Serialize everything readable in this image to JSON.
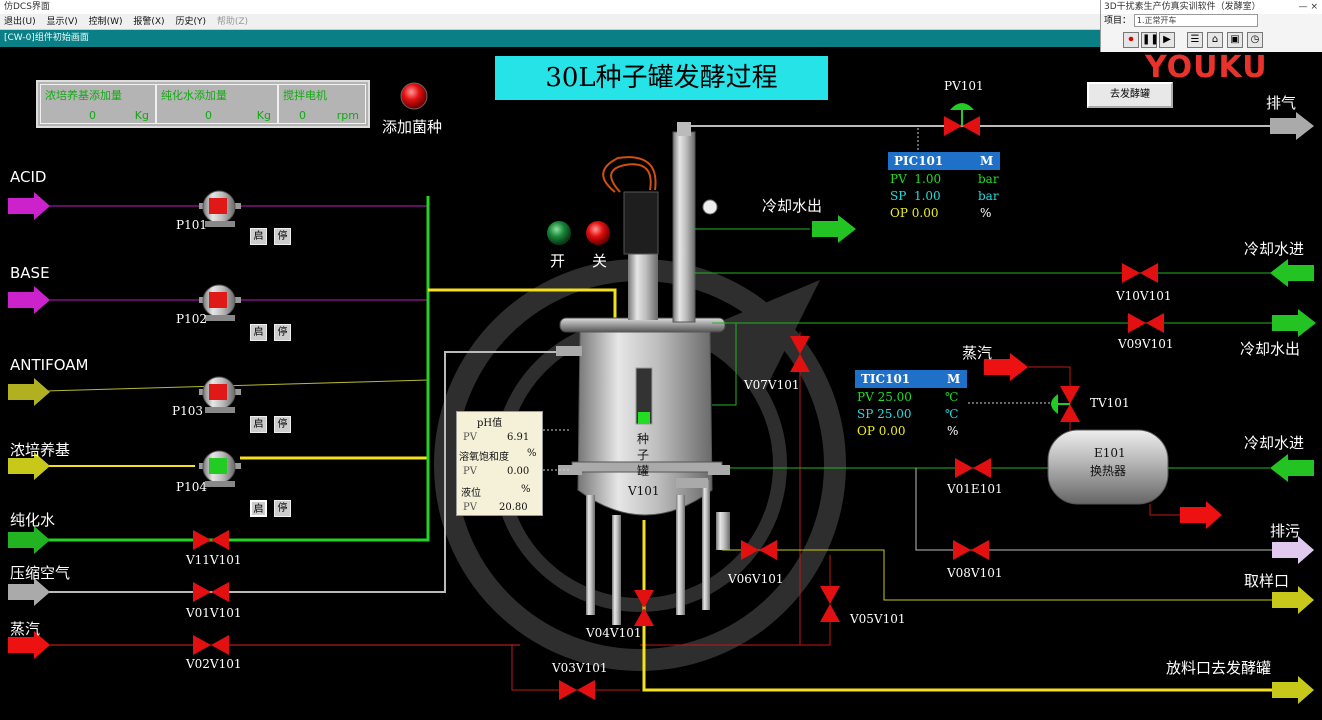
{
  "window": {
    "title": "仿DCS界面",
    "menu": [
      "退出(U)",
      "显示(V)",
      "控制(W)",
      "报警(X)",
      "历史(Y)",
      "帮助(Z)"
    ],
    "tab": "[CW-0]组件初始画面"
  },
  "sim_panel": {
    "title": "3D干扰素生产仿真实训软件（发酵室）",
    "win_controls": "— ×",
    "project_label": "项目：",
    "project_value": "1.正常开车",
    "buttons": [
      "⏺",
      "❚❚",
      "▶",
      "☰",
      "⌂",
      "▣",
      "◷"
    ]
  },
  "watermark": "YOUKU",
  "header": {
    "title": "30L种子罐发酵过程",
    "goto_button": "去发酵罐"
  },
  "dose": {
    "cells": [
      {
        "label": "浓培养基添加量",
        "value": "0",
        "unit": "Kg"
      },
      {
        "label": "纯化水添加量",
        "value": "0",
        "unit": "Kg"
      },
      {
        "label": "搅拌电机",
        "value": "0",
        "unit": "rpm"
      }
    ],
    "add_inoculum": "添加菌种"
  },
  "lines": {
    "acid": "ACID",
    "base": "BASE",
    "antifoam": "ANTIFOAM",
    "nutrient": "浓培养基",
    "pure_water": "纯化水",
    "air": "压缩空气",
    "steam": "蒸汽",
    "exhaust": "排气",
    "cool_out1": "冷却水出",
    "cool_in1": "冷却水进",
    "cool_out2": "冷却水出",
    "steam2": "蒸汽",
    "cool_in2": "冷却水进",
    "drain": "排污",
    "sample": "取样口",
    "discharge": "放料口去发酵罐"
  },
  "pumps": [
    {
      "tag": "P101",
      "state": "off",
      "start": "启",
      "stop": "停"
    },
    {
      "tag": "P102",
      "state": "off",
      "start": "启",
      "stop": "停"
    },
    {
      "tag": "P103",
      "state": "off",
      "start": "启",
      "stop": "停"
    },
    {
      "tag": "P104",
      "state": "on",
      "start": "启",
      "stop": "停"
    }
  ],
  "valves": {
    "v11": "V11V101",
    "v01": "V01V101",
    "v02": "V02V101",
    "v03": "V03V101",
    "v04": "V04V101",
    "v05": "V05V101",
    "v06": "V06V101",
    "v07": "V07V101",
    "v08": "V08V101",
    "v09": "V09V101",
    "v10": "V10V101",
    "v01e": "V01E101",
    "pv101": "PV101",
    "tv101": "TV101"
  },
  "vessel": {
    "tag": "V101",
    "name": [
      "种",
      "子",
      "罐"
    ],
    "on_label": "开",
    "off_label": "关"
  },
  "exchanger": {
    "tag": "E101",
    "name": "换热器"
  },
  "pic": {
    "tag": "PIC101",
    "mode": "M",
    "pv_label": "PV",
    "pv": "1.00",
    "pv_unit": "bar",
    "sp_label": "SP",
    "sp": "1.00",
    "sp_unit": "bar",
    "op_label": "OP",
    "op": "0.00",
    "op_unit": "%"
  },
  "tic": {
    "tag": "TIC101",
    "mode": "M",
    "pv_label": "PV",
    "pv": "25.00",
    "pv_unit": "℃",
    "sp_label": "SP",
    "sp": "25.00",
    "sp_unit": "℃",
    "op_label": "OP",
    "op": "0.00",
    "op_unit": "%"
  },
  "analyzer": {
    "ph_title": "pH值",
    "ph_pv_label": "PV",
    "ph_pv": "6.91",
    "do_title": "溶氧饱和度",
    "do_unit": "%",
    "do_pv_label": "PV",
    "do_pv": "0.00",
    "lvl_title": "液位",
    "lvl_unit": "%",
    "lvl_pv_label": "PV",
    "lvl_pv": "20.80"
  },
  "colors": {
    "title_bg": "#26e3e8",
    "valve": "#ee1111",
    "green_flow": "#22c322",
    "yellow_flow": "#f3e21a",
    "magenta_flow": "#cc22cc",
    "olive_flow": "#b0b020",
    "grey_flow": "#aaaaaa",
    "tag_bar": "#1e70c8"
  }
}
